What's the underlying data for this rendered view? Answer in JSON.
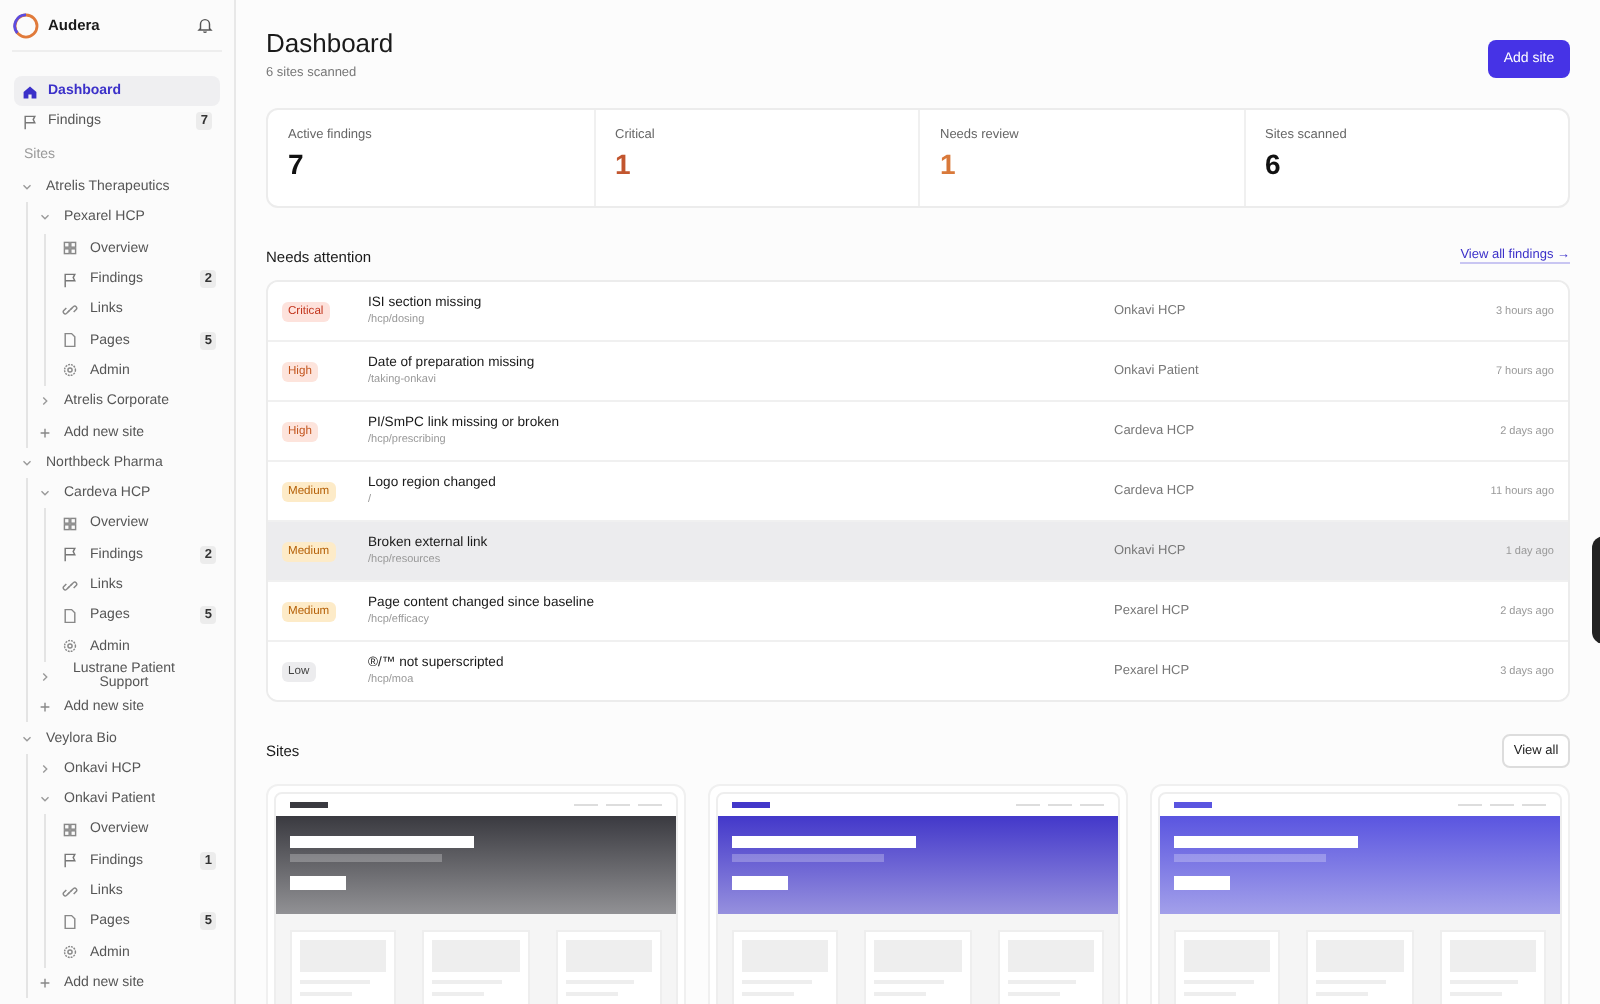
{
  "sidebar": {
    "brand": "Audera",
    "nav": [
      {
        "label": "Dashboard",
        "kind": "home",
        "selected": true
      },
      {
        "label": "Findings",
        "kind": "flag",
        "selected": false,
        "count": "7"
      }
    ],
    "sites_heading": "Sites",
    "orgs": [
      {
        "name": "Atrelis Therapeutics",
        "expanded": true,
        "add_label": "Add new site",
        "sites": [
          {
            "name": "Pexarel HCP",
            "expanded": true,
            "pages": [
              {
                "label": "Overview",
                "kind": "overview"
              },
              {
                "label": "Findings",
                "kind": "flag",
                "count": "2"
              },
              {
                "label": "Links",
                "kind": "link"
              },
              {
                "label": "Pages",
                "kind": "page",
                "count": "5"
              },
              {
                "label": "Admin",
                "kind": "admin"
              }
            ]
          },
          {
            "name": "Atrelis Corporate",
            "expanded": false
          }
        ]
      },
      {
        "name": "Northbeck Pharma",
        "expanded": true,
        "add_label": "Add new site",
        "sites": [
          {
            "name": "Cardeva HCP",
            "expanded": true,
            "pages": [
              {
                "label": "Overview",
                "kind": "overview"
              },
              {
                "label": "Findings",
                "kind": "flag",
                "count": "2"
              },
              {
                "label": "Links",
                "kind": "link"
              },
              {
                "label": "Pages",
                "kind": "page",
                "count": "5"
              },
              {
                "label": "Admin",
                "kind": "admin"
              }
            ]
          },
          {
            "name": "Lustrane Patient Support",
            "expanded": false
          }
        ]
      },
      {
        "name": "Veylora Bio",
        "expanded": true,
        "add_label": "Add new site",
        "sites": [
          {
            "name": "Onkavi HCP",
            "expanded": false
          },
          {
            "name": "Onkavi Patient",
            "expanded": true,
            "pages": [
              {
                "label": "Overview",
                "kind": "overview"
              },
              {
                "label": "Findings",
                "kind": "flag",
                "count": "1"
              },
              {
                "label": "Links",
                "kind": "link"
              },
              {
                "label": "Pages",
                "kind": "page",
                "count": "5"
              },
              {
                "label": "Admin",
                "kind": "admin"
              }
            ]
          }
        ]
      }
    ]
  },
  "header": {
    "title": "Dashboard",
    "subtitle": "6 sites scanned",
    "action": "Add site"
  },
  "stats": [
    {
      "label": "Active findings",
      "value": "7",
      "color": "#111111"
    },
    {
      "label": "Critical",
      "value": "1",
      "color": "#c2562f"
    },
    {
      "label": "Needs review",
      "value": "1",
      "color": "#d9793a"
    },
    {
      "label": "Sites scanned",
      "value": "6",
      "color": "#111111"
    }
  ],
  "attention": {
    "title": "Needs attention",
    "link": "View all findings →",
    "rows": [
      {
        "severity": "Critical",
        "kind": "critical",
        "title": "ISI section missing",
        "path": "/hcp/dosing",
        "site": "Onkavi HCP",
        "time": "3 hours ago",
        "highlighted": false
      },
      {
        "severity": "High",
        "kind": "high",
        "title": "Date of preparation missing",
        "path": "/taking-onkavi",
        "site": "Onkavi Patient",
        "time": "7 hours ago",
        "highlighted": false
      },
      {
        "severity": "High",
        "kind": "high",
        "title": "PI/SmPC link missing or broken",
        "path": "/hcp/prescribing",
        "site": "Cardeva HCP",
        "time": "2 days ago",
        "highlighted": false
      },
      {
        "severity": "Medium",
        "kind": "medium",
        "title": "Logo region changed",
        "path": "/",
        "site": "Cardeva HCP",
        "time": "11 hours ago",
        "highlighted": false
      },
      {
        "severity": "Medium",
        "kind": "medium",
        "title": "Broken external link",
        "path": "/hcp/resources",
        "site": "Onkavi HCP",
        "time": "1 day ago",
        "highlighted": true
      },
      {
        "severity": "Medium",
        "kind": "medium",
        "title": "Page content changed since baseline",
        "path": "/hcp/efficacy",
        "site": "Pexarel HCP",
        "time": "2 days ago",
        "highlighted": false
      },
      {
        "severity": "Low",
        "kind": "low",
        "title": "®/™ not superscripted",
        "path": "/hcp/moa",
        "site": "Pexarel HCP",
        "time": "3 days ago",
        "highlighted": false
      }
    ]
  },
  "sites": {
    "title": "Sites",
    "action": "View all",
    "cards": [
      {
        "color": "#3a3a40"
      },
      {
        "color": "#4338ca"
      },
      {
        "color": "#5a55e0"
      }
    ]
  }
}
